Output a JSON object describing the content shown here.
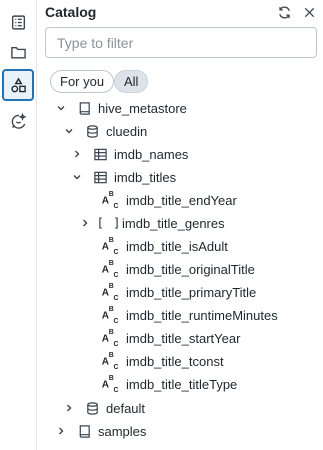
{
  "rail": {
    "items": [
      {
        "name": "workspace-icon",
        "active": false
      },
      {
        "name": "folder-icon",
        "active": false
      },
      {
        "name": "shapes-icon",
        "active": true
      },
      {
        "name": "assistant-icon",
        "active": false
      }
    ]
  },
  "header": {
    "title": "Catalog",
    "refresh_icon": "refresh-icon",
    "close_icon": "close-icon"
  },
  "filter": {
    "placeholder": "Type to filter",
    "value": ""
  },
  "pills": {
    "for_you": "For you",
    "all": "All",
    "selected": "All"
  },
  "tree": {
    "hive_metastore": "hive_metastore",
    "cluedin": "cluedin",
    "imdb_names": "imdb_names",
    "imdb_titles": "imdb_titles",
    "columns": [
      {
        "name": "imdb_title_endYear",
        "type": "string"
      },
      {
        "name": "imdb_title_genres",
        "type": "array"
      },
      {
        "name": "imdb_title_isAdult",
        "type": "string"
      },
      {
        "name": "imdb_title_originalTitle",
        "type": "string"
      },
      {
        "name": "imdb_title_primaryTitle",
        "type": "string"
      },
      {
        "name": "imdb_title_runtimeMinutes",
        "type": "string"
      },
      {
        "name": "imdb_title_startYear",
        "type": "string"
      },
      {
        "name": "imdb_title_tconst",
        "type": "string"
      },
      {
        "name": "imdb_title_titleType",
        "type": "string"
      }
    ],
    "default": "default",
    "samples": "samples",
    "string_glyph": {
      "a": "A",
      "b": "B",
      "c": "C"
    },
    "array_glyph": "[ ]"
  },
  "colors": {
    "accent": "#2272b4",
    "text": "#1f272d",
    "muted": "#8d9399",
    "border": "#c0c6cc"
  }
}
